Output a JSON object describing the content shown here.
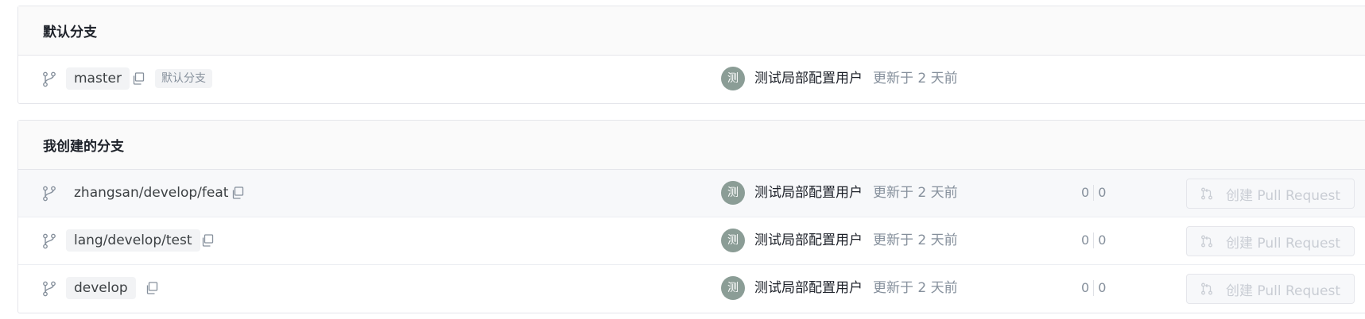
{
  "default_section": {
    "title": "默认分支",
    "branch": {
      "name": "master",
      "tag": "默认分支",
      "avatar_text": "测",
      "user": "测试局部配置用户",
      "updated": "更新于 2 天前"
    }
  },
  "mine_section": {
    "title": "我创建的分支",
    "branches": [
      {
        "name": "zhangsan/develop/feat",
        "avatar_text": "测",
        "user": "测试局部配置用户",
        "updated": "更新于 2 天前",
        "behind": "0",
        "ahead": "0",
        "pr_label": "创建 Pull Request"
      },
      {
        "name": "lang/develop/test",
        "avatar_text": "测",
        "user": "测试局部配置用户",
        "updated": "更新于 2 天前",
        "behind": "0",
        "ahead": "0",
        "pr_label": "创建 Pull Request"
      },
      {
        "name": "develop",
        "avatar_text": "测",
        "user": "测试局部配置用户",
        "updated": "更新于 2 天前",
        "behind": "0",
        "ahead": "0",
        "pr_label": "创建 Pull Request"
      }
    ]
  },
  "icons": {
    "branch": "git-branch-icon",
    "copy": "copy-icon",
    "pull_request": "pull-request-icon"
  },
  "colors": {
    "avatar": "#8b9d96",
    "muted_text": "#86909c",
    "disabled_text": "#c9cdd4",
    "header_bg": "#fafafa"
  }
}
